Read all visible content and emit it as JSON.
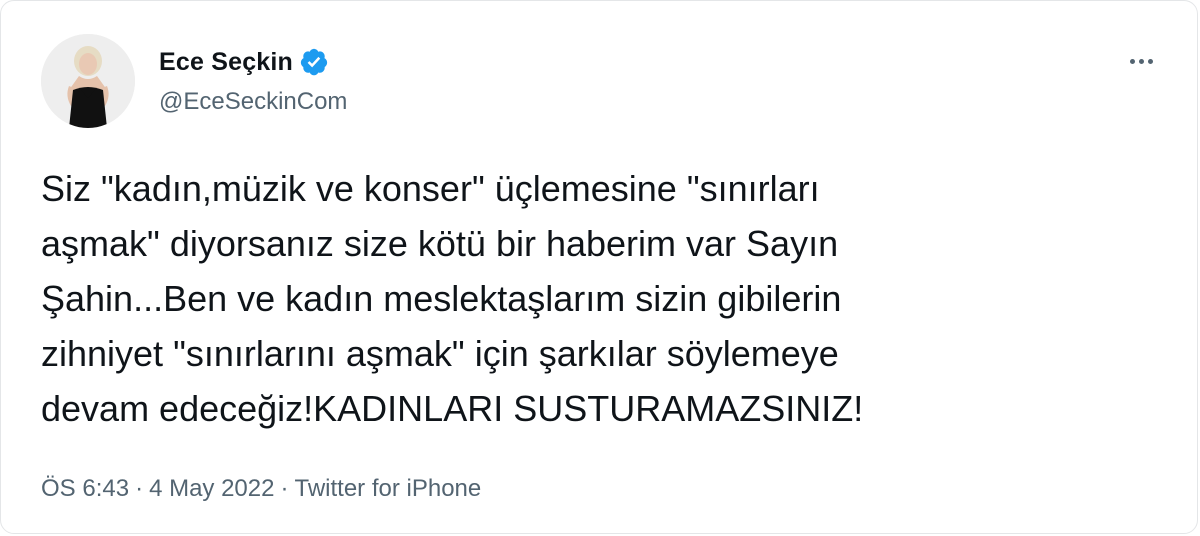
{
  "author": {
    "display_name": "Ece Seçkin",
    "handle": "@EceSeckinCom",
    "verified": true,
    "verified_color": "#1d9bf0",
    "avatar_icon": "profile-photo"
  },
  "tweet": {
    "lines": [
      "Siz \"kadın,müzik ve konser\" üçlemesine \"sınırları",
      "aşmak\" diyorsanız size kötü bir haberim var Sayın",
      "Şahin...Ben ve kadın meslektaşlarım sizin gibilerin",
      "zihniyet \"sınırlarını aşmak\" için şarkılar söylemeye",
      "devam edeceğiz!KADINLARI SUSTURAMAZSINIZ!"
    ]
  },
  "meta": {
    "time": "ÖS 6:43",
    "separator": "·",
    "date": "4 May 2022",
    "source": "Twitter for iPhone"
  },
  "menu": {
    "icon": "more-options-icon"
  },
  "colors": {
    "text": "#0f1419",
    "secondary": "#536471",
    "border": "#e4e6e8"
  }
}
